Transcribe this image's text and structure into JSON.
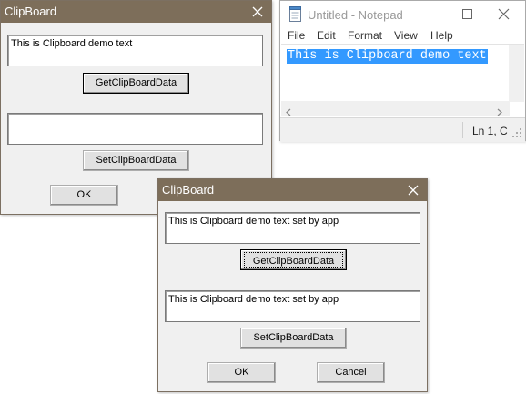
{
  "notepad": {
    "title": "Untitled - Notepad",
    "menu": [
      "File",
      "Edit",
      "Format",
      "View",
      "Help"
    ],
    "content": "This is Clipboard demo text",
    "status_position": "Ln 1, C"
  },
  "dialog1": {
    "title": "ClipBoard",
    "edit_top": "This is Clipboard demo text",
    "get_button": "GetClipBoardData",
    "edit_bottom": "",
    "set_button": "SetClipBoardData",
    "ok_button": "OK"
  },
  "dialog2": {
    "title": "ClipBoard",
    "edit_top": "This is Clipboard demo text set by app",
    "get_button": "GetClipBoardData",
    "edit_bottom": "This is Clipboard demo text set by app",
    "set_button": "SetClipBoardData",
    "ok_button": "OK",
    "cancel_button": "Cancel"
  },
  "colors": {
    "dialog_titlebar": "#7d6e5a",
    "selection": "#3399ff",
    "dialog_background": "#f0f0f0"
  },
  "icons": [
    "close-icon",
    "minimize-icon",
    "maximize-icon",
    "notepad-app-icon",
    "chevron-left-icon",
    "chevron-right-icon",
    "resize-grip-icon"
  ]
}
